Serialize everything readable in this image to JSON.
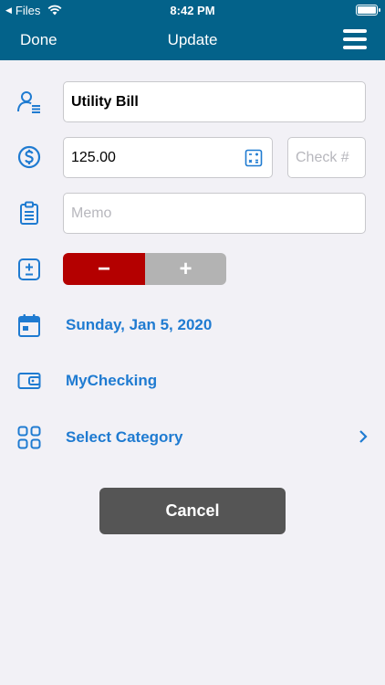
{
  "status_bar": {
    "back_app": "Files",
    "time": "8:42 PM"
  },
  "nav": {
    "done_label": "Done",
    "title": "Update"
  },
  "form": {
    "payee_value": "Utility Bill",
    "amount_value": "125.00",
    "check_placeholder": "Check #",
    "memo_placeholder": "Memo",
    "minus_label": "−",
    "plus_label": "+",
    "date_label": "Sunday, Jan 5, 2020",
    "account_label": "MyChecking",
    "category_label": "Select Category"
  },
  "actions": {
    "cancel_label": "Cancel"
  },
  "colors": {
    "header": "#03628a",
    "accent": "#1f7bd1",
    "minus_active": "#b40000",
    "plus_inactive": "#b3b3b3",
    "cancel": "#555555"
  },
  "icons": [
    "payee-icon",
    "dollar-coin-icon",
    "calculator-icon",
    "clipboard-icon",
    "plus-minus-icon",
    "calendar-icon",
    "wallet-icon",
    "grid-icon",
    "chevron-right-icon",
    "menu-icon",
    "wifi-icon",
    "battery-icon"
  ]
}
